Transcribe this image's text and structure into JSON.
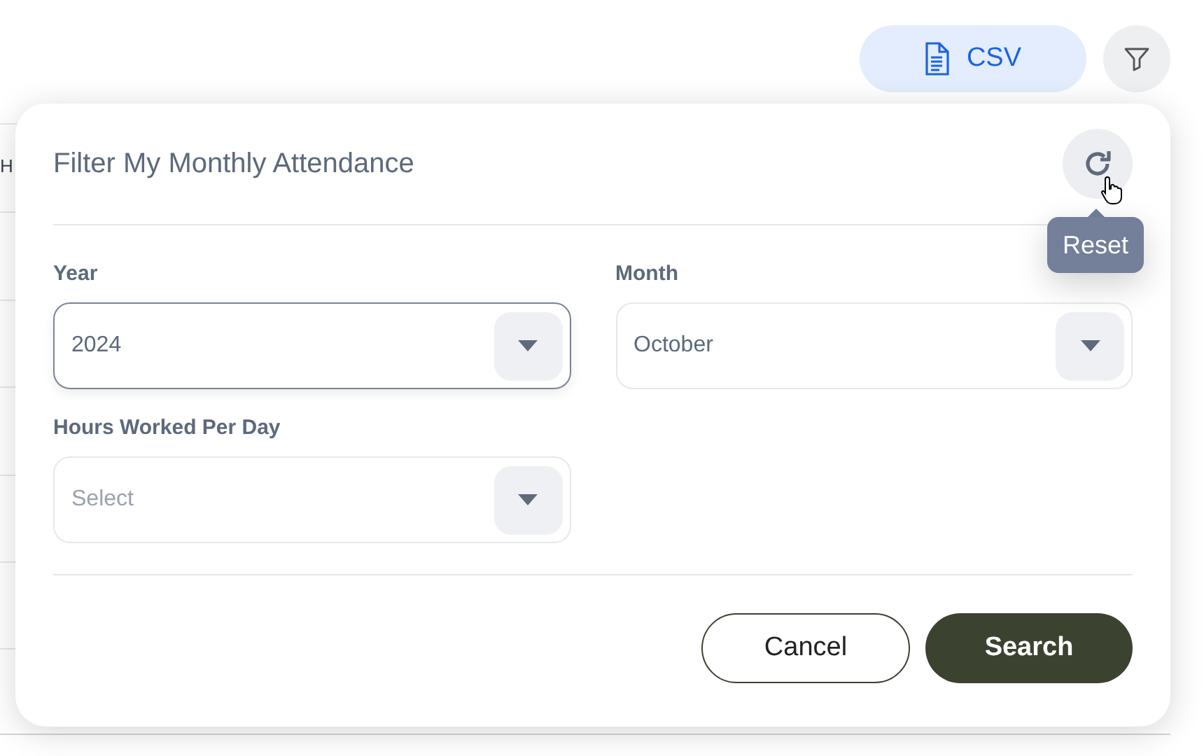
{
  "background_table": {
    "header_fragment": "H"
  },
  "toolbar": {
    "csv_button": "CSV"
  },
  "filter_panel": {
    "title": "Filter My Monthly Attendance",
    "reset_tooltip": "Reset",
    "fields": [
      {
        "label": "Year",
        "value": "2024",
        "focused": true
      },
      {
        "label": "Month",
        "value": "October",
        "focused": false
      },
      {
        "label": "Hours Worked Per Day",
        "placeholder": "Select",
        "focused": false
      }
    ],
    "buttons": [
      {
        "label": "Cancel",
        "kind": "outline"
      },
      {
        "label": "Search",
        "kind": "primary"
      }
    ]
  }
}
